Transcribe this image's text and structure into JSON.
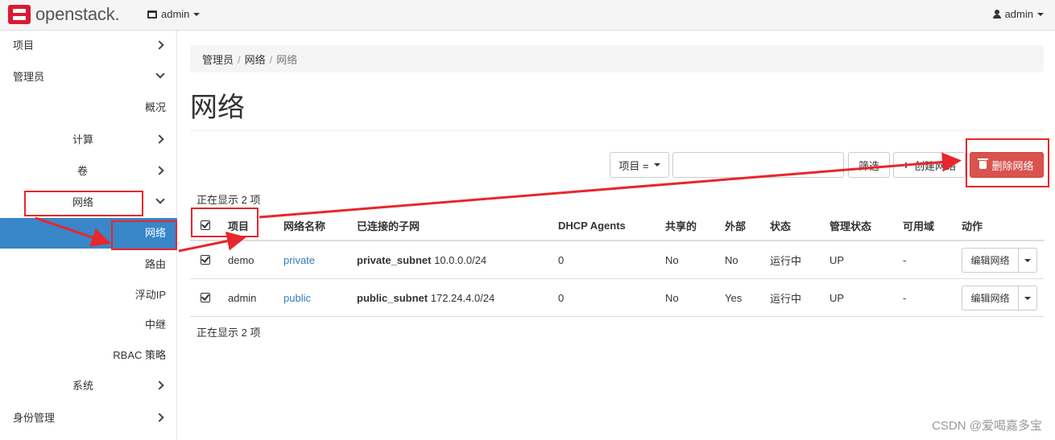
{
  "navbar": {
    "logo_text": "openstack.",
    "project_switcher": "admin",
    "user": "admin"
  },
  "sidebar": {
    "items": [
      {
        "label": "项目",
        "indicator": "chevron-right"
      },
      {
        "label": "管理员",
        "indicator": "chevron-down"
      },
      {
        "label": "概况"
      },
      {
        "label": "计算",
        "indicator": "chevron-right"
      },
      {
        "label": "卷",
        "indicator": "chevron-right"
      },
      {
        "label": "网络",
        "indicator": "chevron-down"
      },
      {
        "label": "网络",
        "active": true
      },
      {
        "label": "路由"
      },
      {
        "label": "浮动IP"
      },
      {
        "label": "中继"
      },
      {
        "label": "RBAC 策略"
      },
      {
        "label": "系统",
        "indicator": "chevron-right"
      },
      {
        "label": "身份管理",
        "indicator": "chevron-right"
      }
    ]
  },
  "breadcrumb": [
    "管理员",
    "网络",
    "网络"
  ],
  "page_title": "网络",
  "toolbar": {
    "filter_select": "项目 =",
    "filter_input_value": "",
    "filter_button": "筛选",
    "create_button": "创建网络",
    "delete_button": "删除网络"
  },
  "count_text": "正在显示 2 项",
  "table": {
    "headers": [
      "项目",
      "网络名称",
      "已连接的子网",
      "DHCP Agents",
      "共享的",
      "外部",
      "状态",
      "管理状态",
      "可用域",
      "动作"
    ],
    "rows": [
      {
        "project": "demo",
        "name": "private",
        "subnet_name": "private_subnet",
        "subnet_cidr": "10.0.0.0/24",
        "dhcp_agents": "0",
        "shared": "No",
        "external": "No",
        "status": "运行中",
        "admin_state": "UP",
        "az": "-",
        "action": "编辑网络"
      },
      {
        "project": "admin",
        "name": "public",
        "subnet_name": "public_subnet",
        "subnet_cidr": "172.24.4.0/24",
        "dhcp_agents": "0",
        "shared": "No",
        "external": "Yes",
        "status": "运行中",
        "admin_state": "UP",
        "az": "-",
        "action": "编辑网络"
      }
    ]
  },
  "colors": {
    "brand_red": "#da1a32",
    "active_nav": "#3986c8",
    "danger": "#d9534f",
    "link": "#337ab7",
    "annotation": "#e8262c"
  },
  "watermark": "CSDN @爱喝嘉多宝"
}
